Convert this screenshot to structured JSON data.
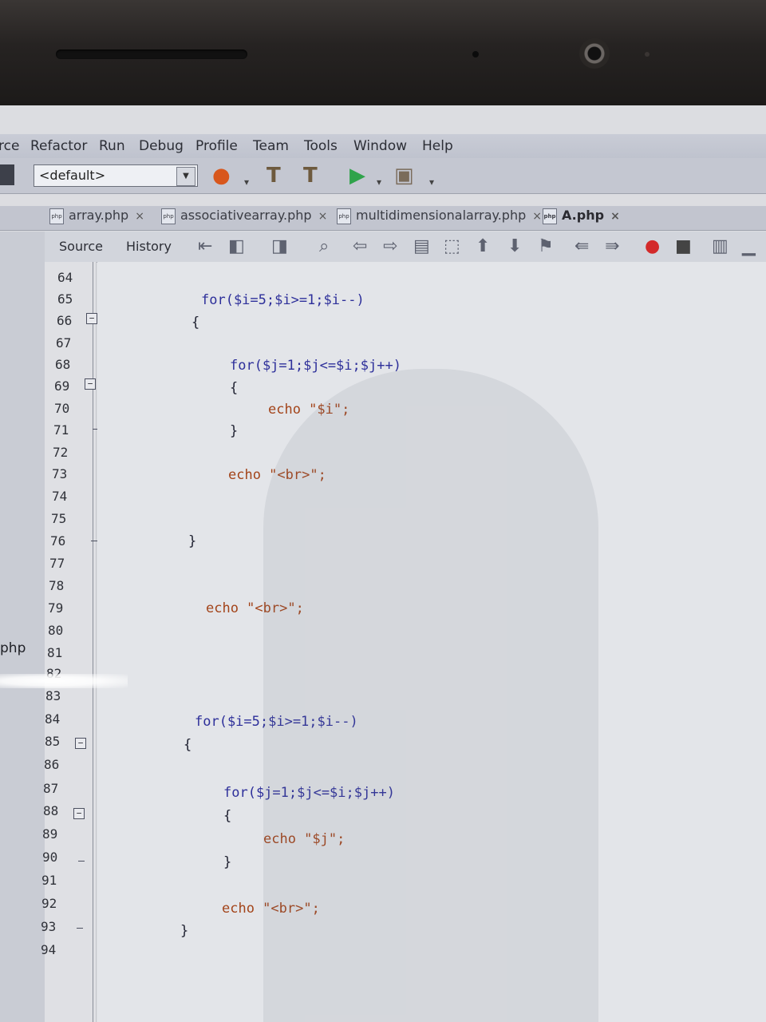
{
  "menu": [
    "rce",
    "Refactor",
    "Run",
    "Debug",
    "Profile",
    "Team",
    "Tools",
    "Window",
    "Help"
  ],
  "toolbar": {
    "config_value": "<default>"
  },
  "tabs": [
    {
      "label": "array.php",
      "active": false
    },
    {
      "label": "associativearray.php",
      "active": false
    },
    {
      "label": "multidimensionalarray.php",
      "active": false
    },
    {
      "label": "A.php",
      "active": true
    }
  ],
  "editor_toolbar": {
    "source_label": "Source",
    "history_label": "History"
  },
  "left_panel_label": "php",
  "line_numbers": [
    "64",
    "65",
    "66",
    "67",
    "68",
    "69",
    "70",
    "71",
    "72",
    "73",
    "74",
    "75",
    "76",
    "77",
    "78",
    "79",
    "80",
    "81",
    "82",
    "83",
    "84",
    "85",
    "86",
    "87",
    "88",
    "89",
    "90",
    "91",
    "92",
    "93",
    "94"
  ],
  "code_lines": [
    {
      "line": "65",
      "text": "for($i=5;$i>=1;$i--)"
    },
    {
      "line": "66",
      "text": "{"
    },
    {
      "line": "68",
      "text": "for($j=1;$j<=$i;$j++)"
    },
    {
      "line": "69",
      "text": "{"
    },
    {
      "line": "70",
      "text": "echo \"$i\";"
    },
    {
      "line": "71",
      "text": "}"
    },
    {
      "line": "73",
      "text": "echo \"<br>\";"
    },
    {
      "line": "76",
      "text": "}"
    },
    {
      "line": "79",
      "text": "echo \"<br>\";"
    },
    {
      "line": "84",
      "text": "for($i=5;$i>=1;$i--)"
    },
    {
      "line": "85",
      "text": "{"
    },
    {
      "line": "87",
      "text": "for($j=1;$j<=$i;$j++)"
    },
    {
      "line": "88",
      "text": "{"
    },
    {
      "line": "89",
      "text": "echo \"$j\";"
    },
    {
      "line": "90",
      "text": "}"
    },
    {
      "line": "92",
      "text": "echo \"<br>\";"
    },
    {
      "line": "93",
      "text": "}"
    }
  ]
}
